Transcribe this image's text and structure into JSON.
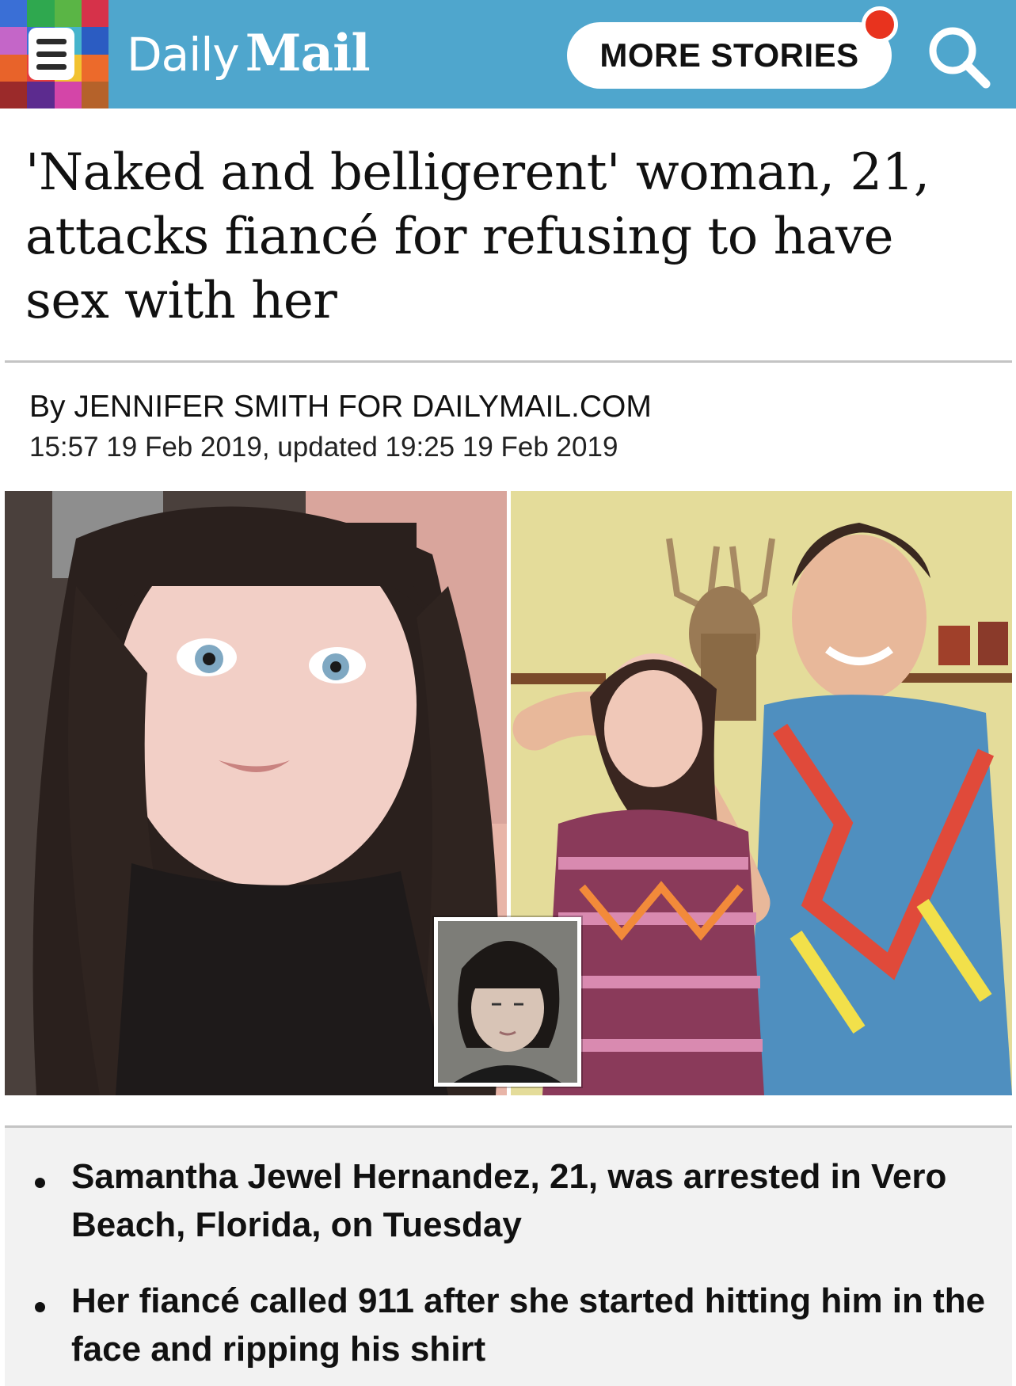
{
  "header": {
    "brand_daily": "Daily",
    "brand_mail": "Mail",
    "more_stories_label": "MORE STORIES",
    "menu_tile_colors": [
      "#3a6fd6",
      "#2fa84f",
      "#5ab545",
      "#d6324a",
      "#c466c8",
      "#3b6fd6",
      "#46b4cc",
      "#2b5cc2",
      "#e8632a",
      "#e63d3d",
      "#f2c230",
      "#ec6a2b",
      "#9b2a2a",
      "#5c2b8f",
      "#d445a8",
      "#b5622a"
    ],
    "accent_color": "#4fa6cd",
    "notification_color": "#e8331e"
  },
  "article": {
    "headline": "'Naked and belligerent' woman, 21, attacks fiancé for refusing to have sex with her",
    "byline": "By JENNIFER SMITH FOR DAILYMAIL.COM",
    "dateline": "15:57 19 Feb 2019, updated 19:25 19 Feb 2019",
    "bullets": [
      "Samantha Jewel Hernandez, 21, was arrested in Vero Beach, Florida, on Tuesday",
      "Her fiancé called 911 after she started hitting him in the face and ripping his shirt"
    ]
  }
}
